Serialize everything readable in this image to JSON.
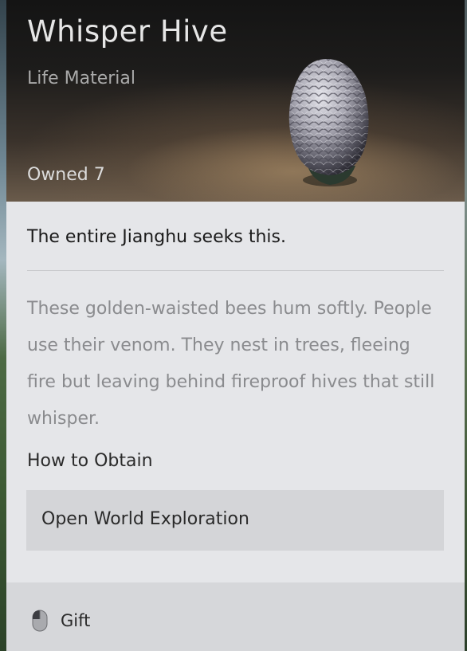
{
  "item": {
    "name": "Whisper Hive",
    "category": "Life Material",
    "owned": "Owned 7",
    "tagline": "The entire Jianghu seeks this.",
    "description": "These golden-waisted bees hum softly. People use their venom. They nest in trees, fleeing fire but leaving behind fireproof hives that still whisper.",
    "obtain_heading": "How to Obtain",
    "obtain_source": "Open World Exploration"
  },
  "footer": {
    "gift_label": "Gift",
    "gift_icon": "mouse-icon"
  }
}
